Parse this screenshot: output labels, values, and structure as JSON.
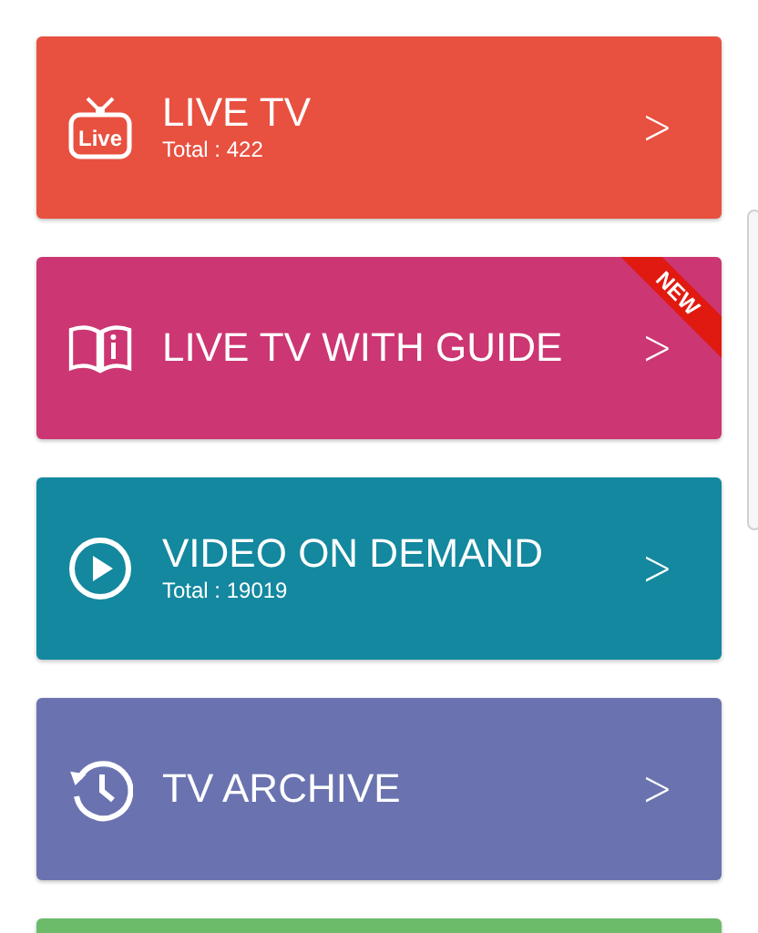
{
  "menu": [
    {
      "title": "LIVE TV",
      "subtitle": "Total : 422",
      "icon_label": "Live",
      "color": "#e8503f",
      "chevron": ">"
    },
    {
      "title": "LIVE TV WITH GUIDE",
      "ribbon": "NEW",
      "color": "#cc3672",
      "chevron": ">"
    },
    {
      "title": "VIDEO ON DEMAND",
      "subtitle": "Total : 19019",
      "color": "#13889f",
      "chevron": ">"
    },
    {
      "title": "TV ARCHIVE",
      "color": "#6a73b0",
      "chevron": ">"
    },
    {
      "color": "#6cbb6a"
    }
  ]
}
